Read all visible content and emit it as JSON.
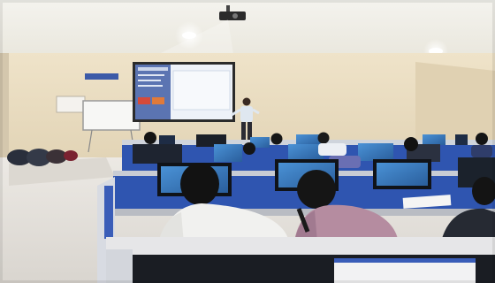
{
  "photo": {
    "colors": {
      "wall": "#e9dcc4",
      "ceiling": "#f2f1ea",
      "floor": "#e6e3de",
      "partition_blue": "#2f55b0",
      "monitor_screen": "#3b7fc4",
      "projection": "#e8eef7"
    },
    "projection_screen": {
      "logo_lines": [],
      "menu_lines": []
    }
  }
}
